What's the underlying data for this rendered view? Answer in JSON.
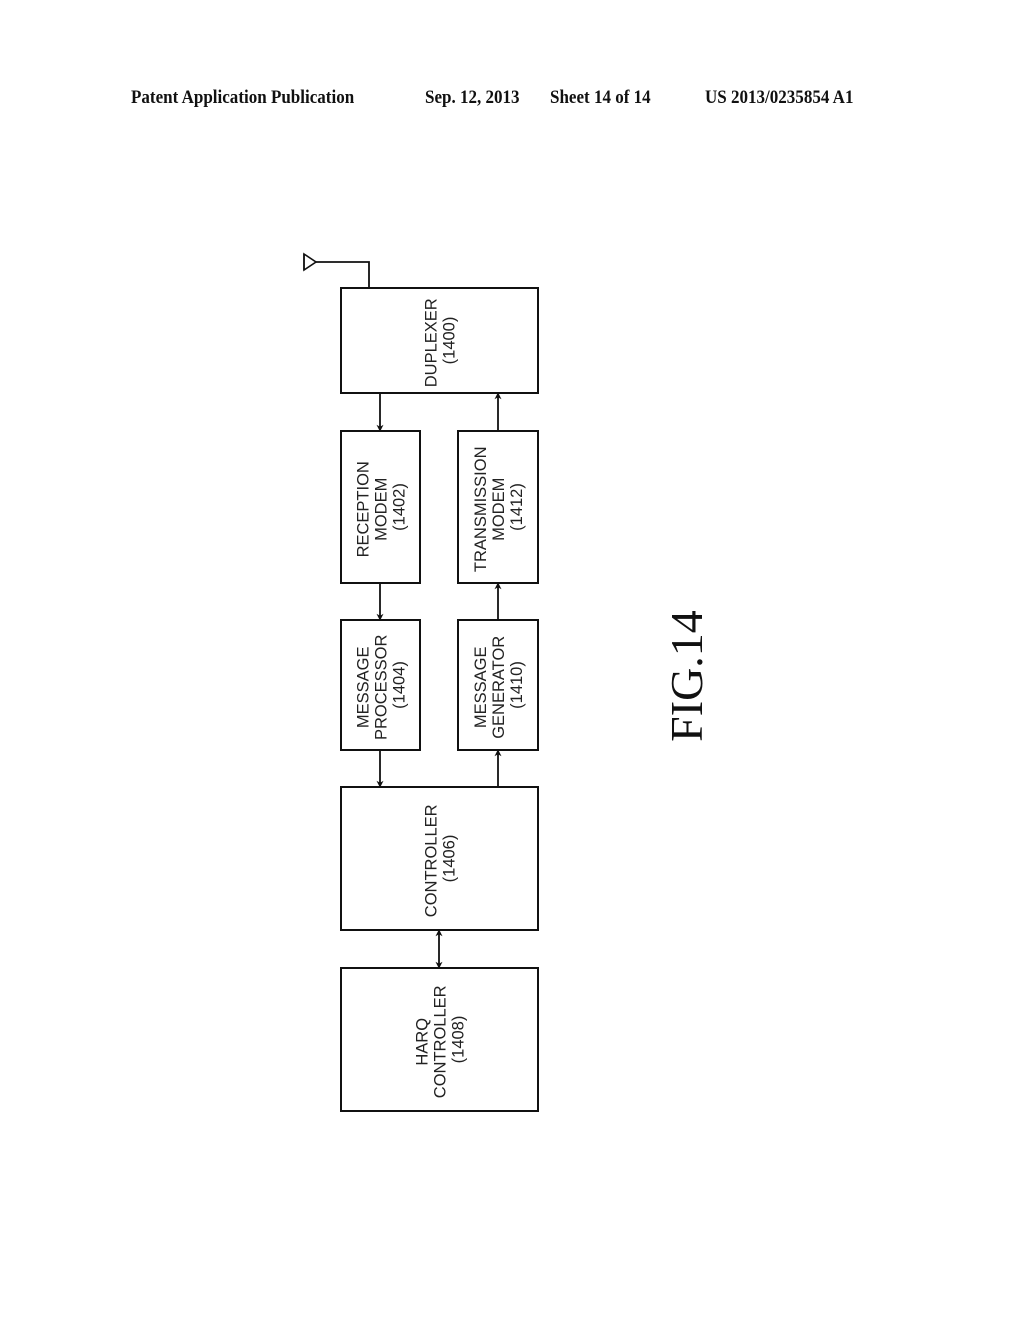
{
  "header": {
    "publication": "Patent Application Publication",
    "date": "Sep. 12, 2013",
    "sheet": "Sheet 14 of 14",
    "patent_number": "US 2013/0235854 A1"
  },
  "figure": {
    "label": "FIG.14"
  },
  "blocks": {
    "duplexer": {
      "lines": [
        "DUPLEXER",
        "(1400)"
      ]
    },
    "reception_modem": {
      "lines": [
        "RECEPTION",
        "MODEM",
        "(1402)"
      ]
    },
    "transmission_modem": {
      "lines": [
        "TRANSMISSION",
        "MODEM",
        "(1412)"
      ]
    },
    "message_processor": {
      "lines": [
        "MESSAGE",
        "PROCESSOR",
        "(1404)"
      ]
    },
    "message_generator": {
      "lines": [
        "MESSAGE",
        "GENERATOR",
        "(1410)"
      ]
    },
    "controller": {
      "lines": [
        "CONTROLLER",
        "(1406)"
      ]
    },
    "harq_controller": {
      "lines": [
        "HARQ",
        "CONTROLLER",
        "(1408)"
      ]
    }
  },
  "connections": [
    {
      "from": "antenna",
      "to": "duplexer",
      "type": "line"
    },
    {
      "from": "duplexer",
      "to": "reception_modem",
      "type": "arrow"
    },
    {
      "from": "reception_modem",
      "to": "message_processor",
      "type": "arrow"
    },
    {
      "from": "message_processor",
      "to": "controller",
      "type": "arrow"
    },
    {
      "from": "controller",
      "to": "message_generator",
      "type": "arrow"
    },
    {
      "from": "message_generator",
      "to": "transmission_modem",
      "type": "arrow"
    },
    {
      "from": "transmission_modem",
      "to": "duplexer",
      "type": "arrow"
    },
    {
      "from": "controller",
      "to": "harq_controller",
      "type": "bidirectional"
    }
  ]
}
